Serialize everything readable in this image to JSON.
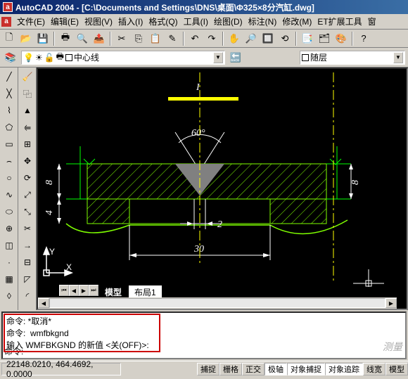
{
  "title": "AutoCAD 2004 - [C:\\Documents and Settings\\DNS\\桌面\\Φ325×8分汽缸.dwg]",
  "menus": [
    "文件(E)",
    "编辑(E)",
    "视图(V)",
    "插入(I)",
    "格式(Q)",
    "工具(I)",
    "绘图(D)",
    "标注(N)",
    "修改(M)",
    "ET扩展工具",
    "窗"
  ],
  "layer": {
    "name": "中心线"
  },
  "linestyle": {
    "name": "随层"
  },
  "tabs": {
    "model": "模型",
    "layout1": "布局1"
  },
  "cmd": {
    "l1": "命令: *取消*",
    "l2": "命令:  wmfbkgnd",
    "l3": "输入 WMFBKGND 的新值 <关(OFF)>:",
    "l4": "命令:"
  },
  "status": {
    "coords": "22148.0210, 464.4692, 0.0000",
    "btns": [
      "捕捉",
      "栅格",
      "正交",
      "极轴",
      "对象捕捉",
      "对象追踪",
      "线宽",
      "模型"
    ]
  },
  "drawing": {
    "labels": {
      "top": "I",
      "angle": "60°",
      "dim_bottom": "30",
      "dim_slot": "2",
      "dim_h1": "8",
      "dim_h2": "4",
      "dim_h3": "8"
    }
  },
  "watermark": "测量"
}
